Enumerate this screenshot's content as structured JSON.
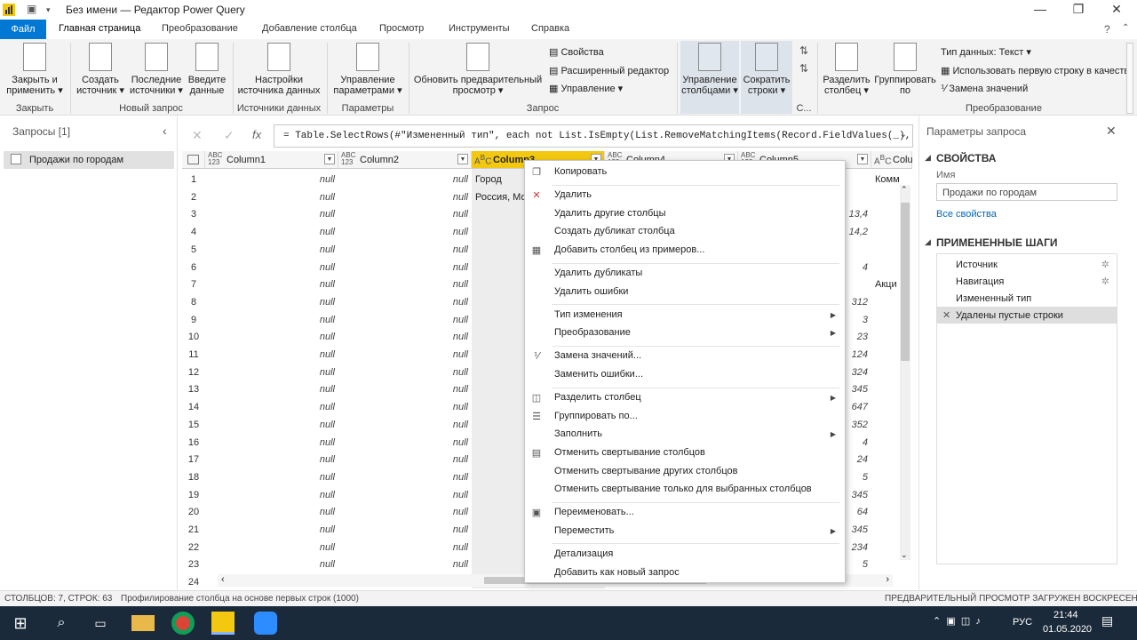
{
  "window": {
    "title": "Без имени — Редактор Power Query"
  },
  "tabs": [
    "Файл",
    "Главная страница",
    "Преобразование",
    "Добавление столбца",
    "Просмотр",
    "Инструменты",
    "Справка"
  ],
  "ribbon": {
    "buttons": [
      {
        "id": "close",
        "label": "Закрыть и применить",
        "l1": "Закрыть и",
        "l2": "применить ▾"
      },
      {
        "id": "new",
        "label": "Создать источник",
        "l1": "Создать",
        "l2": "источник ▾"
      },
      {
        "id": "recent",
        "label": "Последние источники",
        "l1": "Последние",
        "l2": "источники ▾"
      },
      {
        "id": "enter",
        "label": "Введите данные",
        "l1": "Введите",
        "l2": "данные"
      },
      {
        "id": "dsset",
        "label": "Настройки источника данных",
        "l1": "Настройки",
        "l2": "источника данных"
      },
      {
        "id": "params",
        "label": "Управление параметрами",
        "l1": "Управление",
        "l2": "параметрами ▾"
      },
      {
        "id": "refresh",
        "label": "Обновить предварительный просмотр",
        "l1": "Обновить предварительный",
        "l2": "просмотр ▾"
      },
      {
        "id": "cols",
        "label": "Управление столбцами",
        "l1": "Управление",
        "l2": "столбцами ▾"
      },
      {
        "id": "rows",
        "label": "Сократить строки",
        "l1": "Сократить",
        "l2": "строки ▾"
      },
      {
        "id": "split",
        "label": "Разделить столбец",
        "l1": "Разделить",
        "l2": "столбец ▾"
      },
      {
        "id": "group",
        "label": "Группировать по",
        "l1": "Группировать",
        "l2": "по"
      }
    ],
    "small": {
      "props": "Свойства",
      "adv": "Расширенный редактор",
      "manage": "Управление ▾",
      "dtype": "Тип данных: Текст ▾",
      "firstrow": "Использовать первую строку в качеств",
      "replace": "Замена значений"
    },
    "groups": {
      "close": "Закрыть",
      "new": "Новый запрос",
      "ds": "Источники данных",
      "params": "Параметры",
      "query": "Запрос",
      "c": "С...",
      "transform": "Преобразование"
    }
  },
  "queries": {
    "title": "Запросы [1]",
    "items": [
      "Продажи по городам"
    ]
  },
  "formula": "= Table.SelectRows(#\"Измененный тип\", each not List.IsEmpty(List.RemoveMatchingItems(Record.FieldValues(_),",
  "grid": {
    "columns": [
      {
        "name": "Column1",
        "type": "ABC 123"
      },
      {
        "name": "Column2",
        "type": "ABC 123"
      },
      {
        "name": "Column3",
        "type": "A B C"
      },
      {
        "name": "Column4",
        "type": "ABC 123"
      },
      {
        "name": "Column5",
        "type": "ABC 123"
      },
      {
        "name": "Colu",
        "type": "A B C"
      }
    ],
    "rows": [
      {
        "n": "1",
        "c1": "null",
        "c2": "null",
        "c3": "Город",
        "c5": "",
        "c6": "Комм"
      },
      {
        "n": "2",
        "c1": "null",
        "c2": "null",
        "c3": "Россия, Мо",
        "c5": "",
        "c6": ""
      },
      {
        "n": "3",
        "c1": "null",
        "c2": "null",
        "c3": "",
        "c5": "13,4",
        "c6": ""
      },
      {
        "n": "4",
        "c1": "null",
        "c2": "null",
        "c3": "",
        "c5": "14,2",
        "c6": ""
      },
      {
        "n": "5",
        "c1": "null",
        "c2": "null",
        "c3": "",
        "c5": "",
        "c6": ""
      },
      {
        "n": "6",
        "c1": "null",
        "c2": "null",
        "c3": "",
        "c5": "4",
        "c6": ""
      },
      {
        "n": "7",
        "c1": "null",
        "c2": "null",
        "c3": "",
        "c5": "",
        "c6": "Акци"
      },
      {
        "n": "8",
        "c1": "null",
        "c2": "null",
        "c3": "",
        "c5": "312",
        "c6": ""
      },
      {
        "n": "9",
        "c1": "null",
        "c2": "null",
        "c3": "",
        "c5": "3",
        "c6": ""
      },
      {
        "n": "10",
        "c1": "null",
        "c2": "null",
        "c3": "",
        "c5": "23",
        "c6": ""
      },
      {
        "n": "11",
        "c1": "null",
        "c2": "null",
        "c3": "",
        "c5": "124",
        "c6": ""
      },
      {
        "n": "12",
        "c1": "null",
        "c2": "null",
        "c3": "",
        "c5": "324",
        "c6": ""
      },
      {
        "n": "13",
        "c1": "null",
        "c2": "null",
        "c3": "",
        "c5": "345",
        "c6": ""
      },
      {
        "n": "14",
        "c1": "null",
        "c2": "null",
        "c3": "",
        "c5": "647",
        "c6": ""
      },
      {
        "n": "15",
        "c1": "null",
        "c2": "null",
        "c3": "",
        "c5": "352",
        "c6": ""
      },
      {
        "n": "16",
        "c1": "null",
        "c2": "null",
        "c3": "",
        "c5": "4",
        "c6": ""
      },
      {
        "n": "17",
        "c1": "null",
        "c2": "null",
        "c3": "",
        "c5": "24",
        "c6": ""
      },
      {
        "n": "18",
        "c1": "null",
        "c2": "null",
        "c3": "",
        "c5": "5",
        "c6": ""
      },
      {
        "n": "19",
        "c1": "null",
        "c2": "null",
        "c3": "",
        "c5": "345",
        "c6": ""
      },
      {
        "n": "20",
        "c1": "null",
        "c2": "null",
        "c3": "",
        "c5": "64",
        "c6": ""
      },
      {
        "n": "21",
        "c1": "null",
        "c2": "null",
        "c3": "",
        "c5": "345",
        "c6": ""
      },
      {
        "n": "22",
        "c1": "null",
        "c2": "null",
        "c3": "",
        "c5": "234",
        "c6": ""
      },
      {
        "n": "23",
        "c1": "null",
        "c2": "null",
        "c3": "",
        "c5": "5",
        "c6": ""
      },
      {
        "n": "24",
        "c1": "",
        "c2": "",
        "c3": "",
        "c5": "",
        "c6": ""
      }
    ]
  },
  "context_menu": {
    "items": [
      {
        "label": "Копировать",
        "icon": "copy-icon",
        "sub": false,
        "sep": true
      },
      {
        "label": "Удалить",
        "icon": "delete-icon",
        "sub": false,
        "sep": false
      },
      {
        "label": "Удалить другие столбцы",
        "icon": "",
        "sub": false,
        "sep": false
      },
      {
        "label": "Создать дубликат столбца",
        "icon": "",
        "sub": false,
        "sep": false
      },
      {
        "label": "Добавить столбец из примеров...",
        "icon": "add-column-examples-icon",
        "sub": false,
        "sep": true
      },
      {
        "label": "Удалить дубликаты",
        "icon": "",
        "sub": false,
        "sep": false
      },
      {
        "label": "Удалить ошибки",
        "icon": "",
        "sub": false,
        "sep": true
      },
      {
        "label": "Тип изменения",
        "icon": "",
        "sub": true,
        "sep": false
      },
      {
        "label": "Преобразование",
        "icon": "",
        "sub": true,
        "sep": true
      },
      {
        "label": "Замена значений...",
        "icon": "replace-values-icon",
        "sub": false,
        "sep": false
      },
      {
        "label": "Заменить ошибки...",
        "icon": "",
        "sub": false,
        "sep": true
      },
      {
        "label": "Разделить столбец",
        "icon": "split-column-icon",
        "sub": true,
        "sep": false
      },
      {
        "label": "Группировать по...",
        "icon": "group-by-icon",
        "sub": false,
        "sep": false
      },
      {
        "label": "Заполнить",
        "icon": "",
        "sub": true,
        "sep": false
      },
      {
        "label": "Отменить свертывание столбцов",
        "icon": "unpivot-icon",
        "sub": false,
        "sep": false
      },
      {
        "label": "Отменить свертывание других столбцов",
        "icon": "",
        "sub": false,
        "sep": false
      },
      {
        "label": "Отменить свертывание только для выбранных столбцов",
        "icon": "",
        "sub": false,
        "sep": true
      },
      {
        "label": "Переименовать...",
        "icon": "rename-icon",
        "sub": false,
        "sep": false
      },
      {
        "label": "Переместить",
        "icon": "",
        "sub": true,
        "sep": true
      },
      {
        "label": "Детализация",
        "icon": "",
        "sub": false,
        "sep": false
      },
      {
        "label": "Добавить как новый запрос",
        "icon": "",
        "sub": false,
        "sep": false
      }
    ]
  },
  "settings": {
    "title": "Параметры запроса",
    "props_header": "СВОЙСТВА",
    "name_label": "Имя",
    "name_value": "Продажи по городам",
    "all_props": "Все свойства",
    "steps_header": "ПРИМЕНЕННЫЕ ШАГИ",
    "steps": [
      "Источник",
      "Навигация",
      "Измененный тип",
      "Удалены пустые строки"
    ]
  },
  "status": {
    "left": "СТОЛБЦОВ: 7, СТРОК: 63",
    "mid": "Профилирование столбца на основе первых строк (1000)",
    "right": "ПРЕДВАРИТЕЛЬНЫЙ ПРОСМОТР ЗАГРУЖЕН ВОСКРЕСЕНЬЕ"
  },
  "taskbar": {
    "lang": "РУС",
    "time": "21:44",
    "date": "01.05.2020"
  },
  "colors": {
    "accent": "#0078d4",
    "selected_col": "#f2c811",
    "pbi": "#f2c811",
    "taskbar": "#1b2a3a"
  }
}
